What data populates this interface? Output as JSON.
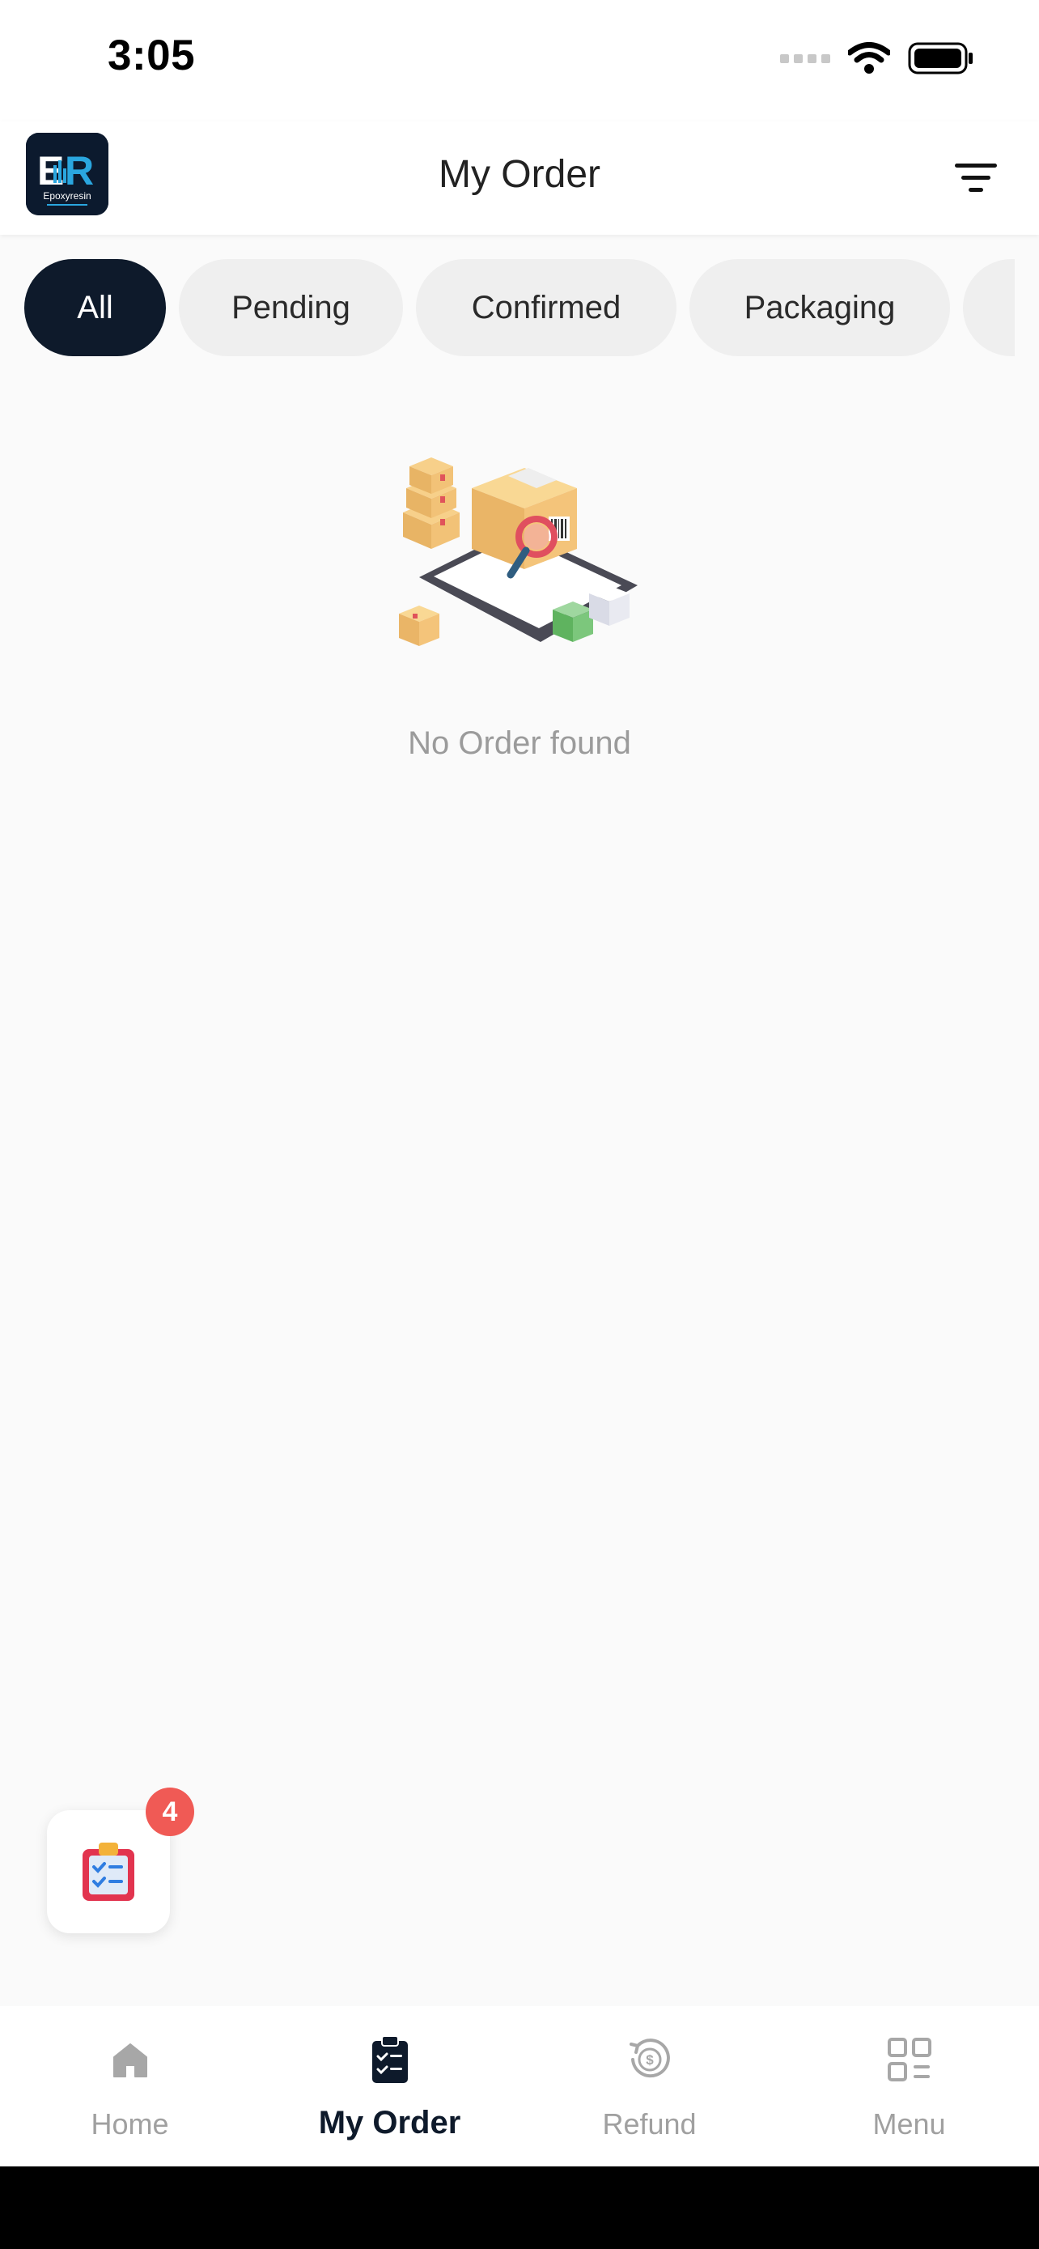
{
  "status_bar": {
    "time": "3:05"
  },
  "header": {
    "title": "My Order",
    "logo_text": "ER",
    "logo_subtext": "Epoxyresin"
  },
  "tabs": [
    {
      "label": "All",
      "active": true
    },
    {
      "label": "Pending",
      "active": false
    },
    {
      "label": "Confirmed",
      "active": false
    },
    {
      "label": "Packaging",
      "active": false
    },
    {
      "label": "",
      "active": false
    }
  ],
  "empty_state": {
    "message": "No Order found"
  },
  "fab": {
    "badge_count": "4"
  },
  "bottom_nav": [
    {
      "label": "Home",
      "icon": "home-icon",
      "active": false
    },
    {
      "label": "My Order",
      "icon": "clipboard-check-icon",
      "active": true
    },
    {
      "label": "Refund",
      "icon": "refund-icon",
      "active": false
    },
    {
      "label": "Menu",
      "icon": "grid-menu-icon",
      "active": false
    }
  ],
  "colors": {
    "primary": "#0e1a2b",
    "badge": "#f05a55",
    "inactive": "#a0a0a0"
  }
}
